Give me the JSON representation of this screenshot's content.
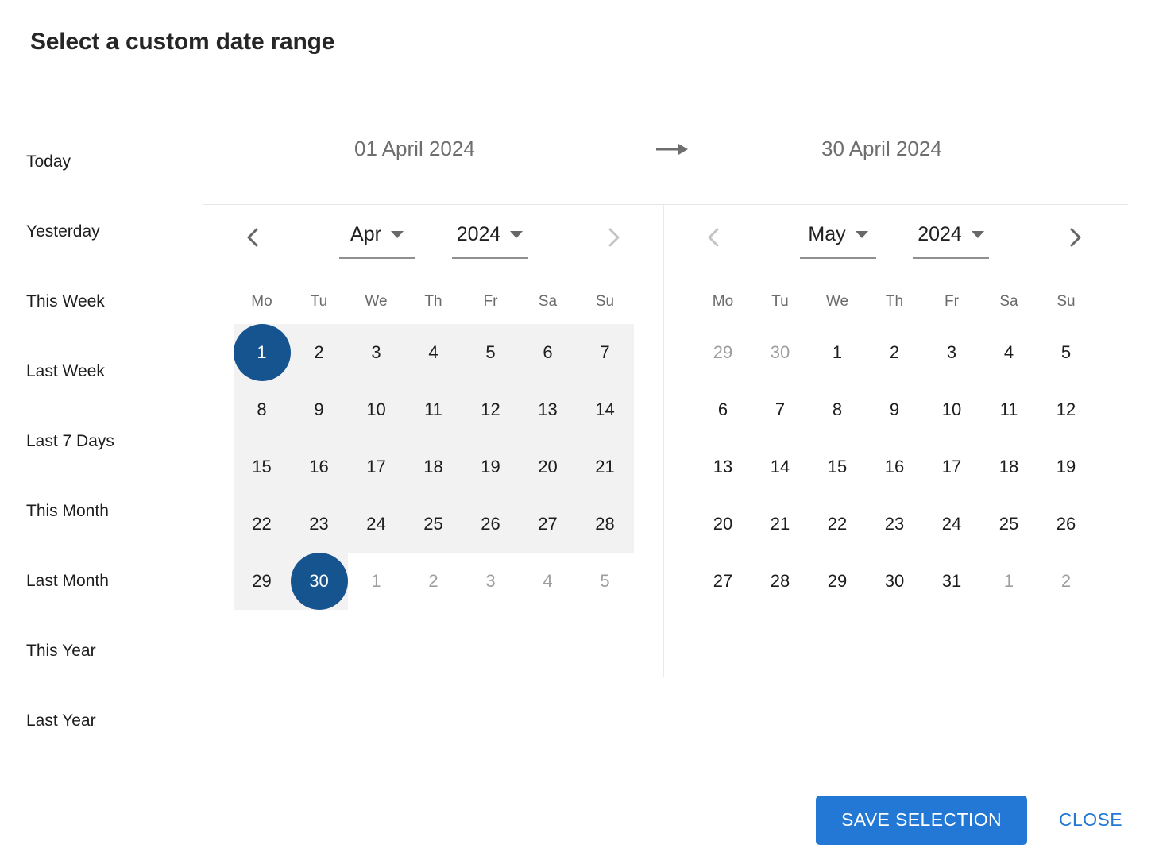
{
  "dialog": {
    "title": "Select a custom date range"
  },
  "presets": {
    "items": [
      {
        "label": "Today"
      },
      {
        "label": "Yesterday"
      },
      {
        "label": "This Week"
      },
      {
        "label": "Last Week"
      },
      {
        "label": "Last 7 Days"
      },
      {
        "label": "This Month"
      },
      {
        "label": "Last Month"
      },
      {
        "label": "This Year"
      },
      {
        "label": "Last Year"
      }
    ]
  },
  "range": {
    "start_label": "01 April 2024",
    "end_label": "30 April 2024",
    "arrow_icon": "arrow-right-icon"
  },
  "weekdays": [
    "Mo",
    "Tu",
    "We",
    "Th",
    "Fr",
    "Sa",
    "Su"
  ],
  "calendars": [
    {
      "id": "left",
      "month": "Apr",
      "year": "2024",
      "prev_icon": "chevron-left-icon",
      "next_icon": "chevron-right-icon",
      "prev_enabled": true,
      "next_enabled": false,
      "weeks": [
        [
          {
            "d": "1",
            "out": false,
            "selected": true,
            "inrange": true
          },
          {
            "d": "2",
            "out": false,
            "selected": false,
            "inrange": true
          },
          {
            "d": "3",
            "out": false,
            "selected": false,
            "inrange": true
          },
          {
            "d": "4",
            "out": false,
            "selected": false,
            "inrange": true
          },
          {
            "d": "5",
            "out": false,
            "selected": false,
            "inrange": true
          },
          {
            "d": "6",
            "out": false,
            "selected": false,
            "inrange": true
          },
          {
            "d": "7",
            "out": false,
            "selected": false,
            "inrange": true
          }
        ],
        [
          {
            "d": "8",
            "out": false,
            "selected": false,
            "inrange": true
          },
          {
            "d": "9",
            "out": false,
            "selected": false,
            "inrange": true
          },
          {
            "d": "10",
            "out": false,
            "selected": false,
            "inrange": true
          },
          {
            "d": "11",
            "out": false,
            "selected": false,
            "inrange": true
          },
          {
            "d": "12",
            "out": false,
            "selected": false,
            "inrange": true
          },
          {
            "d": "13",
            "out": false,
            "selected": false,
            "inrange": true
          },
          {
            "d": "14",
            "out": false,
            "selected": false,
            "inrange": true
          }
        ],
        [
          {
            "d": "15",
            "out": false,
            "selected": false,
            "inrange": true
          },
          {
            "d": "16",
            "out": false,
            "selected": false,
            "inrange": true
          },
          {
            "d": "17",
            "out": false,
            "selected": false,
            "inrange": true
          },
          {
            "d": "18",
            "out": false,
            "selected": false,
            "inrange": true
          },
          {
            "d": "19",
            "out": false,
            "selected": false,
            "inrange": true
          },
          {
            "d": "20",
            "out": false,
            "selected": false,
            "inrange": true
          },
          {
            "d": "21",
            "out": false,
            "selected": false,
            "inrange": true
          }
        ],
        [
          {
            "d": "22",
            "out": false,
            "selected": false,
            "inrange": true
          },
          {
            "d": "23",
            "out": false,
            "selected": false,
            "inrange": true
          },
          {
            "d": "24",
            "out": false,
            "selected": false,
            "inrange": true
          },
          {
            "d": "25",
            "out": false,
            "selected": false,
            "inrange": true
          },
          {
            "d": "26",
            "out": false,
            "selected": false,
            "inrange": true
          },
          {
            "d": "27",
            "out": false,
            "selected": false,
            "inrange": true
          },
          {
            "d": "28",
            "out": false,
            "selected": false,
            "inrange": true
          }
        ],
        [
          {
            "d": "29",
            "out": false,
            "selected": false,
            "inrange": true
          },
          {
            "d": "30",
            "out": false,
            "selected": true,
            "inrange": true
          },
          {
            "d": "1",
            "out": true,
            "selected": false,
            "inrange": false
          },
          {
            "d": "2",
            "out": true,
            "selected": false,
            "inrange": false
          },
          {
            "d": "3",
            "out": true,
            "selected": false,
            "inrange": false
          },
          {
            "d": "4",
            "out": true,
            "selected": false,
            "inrange": false
          },
          {
            "d": "5",
            "out": true,
            "selected": false,
            "inrange": false
          }
        ]
      ]
    },
    {
      "id": "right",
      "month": "May",
      "year": "2024",
      "prev_icon": "chevron-left-icon",
      "next_icon": "chevron-right-icon",
      "prev_enabled": false,
      "next_enabled": true,
      "weeks": [
        [
          {
            "d": "29",
            "out": true,
            "selected": false,
            "inrange": false
          },
          {
            "d": "30",
            "out": true,
            "selected": false,
            "inrange": false
          },
          {
            "d": "1",
            "out": false,
            "selected": false,
            "inrange": false
          },
          {
            "d": "2",
            "out": false,
            "selected": false,
            "inrange": false
          },
          {
            "d": "3",
            "out": false,
            "selected": false,
            "inrange": false
          },
          {
            "d": "4",
            "out": false,
            "selected": false,
            "inrange": false
          },
          {
            "d": "5",
            "out": false,
            "selected": false,
            "inrange": false
          }
        ],
        [
          {
            "d": "6",
            "out": false,
            "selected": false,
            "inrange": false
          },
          {
            "d": "7",
            "out": false,
            "selected": false,
            "inrange": false
          },
          {
            "d": "8",
            "out": false,
            "selected": false,
            "inrange": false
          },
          {
            "d": "9",
            "out": false,
            "selected": false,
            "inrange": false
          },
          {
            "d": "10",
            "out": false,
            "selected": false,
            "inrange": false
          },
          {
            "d": "11",
            "out": false,
            "selected": false,
            "inrange": false
          },
          {
            "d": "12",
            "out": false,
            "selected": false,
            "inrange": false
          }
        ],
        [
          {
            "d": "13",
            "out": false,
            "selected": false,
            "inrange": false
          },
          {
            "d": "14",
            "out": false,
            "selected": false,
            "inrange": false
          },
          {
            "d": "15",
            "out": false,
            "selected": false,
            "inrange": false
          },
          {
            "d": "16",
            "out": false,
            "selected": false,
            "inrange": false
          },
          {
            "d": "17",
            "out": false,
            "selected": false,
            "inrange": false
          },
          {
            "d": "18",
            "out": false,
            "selected": false,
            "inrange": false
          },
          {
            "d": "19",
            "out": false,
            "selected": false,
            "inrange": false
          }
        ],
        [
          {
            "d": "20",
            "out": false,
            "selected": false,
            "inrange": false
          },
          {
            "d": "21",
            "out": false,
            "selected": false,
            "inrange": false
          },
          {
            "d": "22",
            "out": false,
            "selected": false,
            "inrange": false
          },
          {
            "d": "23",
            "out": false,
            "selected": false,
            "inrange": false
          },
          {
            "d": "24",
            "out": false,
            "selected": false,
            "inrange": false
          },
          {
            "d": "25",
            "out": false,
            "selected": false,
            "inrange": false
          },
          {
            "d": "26",
            "out": false,
            "selected": false,
            "inrange": false
          }
        ],
        [
          {
            "d": "27",
            "out": false,
            "selected": false,
            "inrange": false
          },
          {
            "d": "28",
            "out": false,
            "selected": false,
            "inrange": false
          },
          {
            "d": "29",
            "out": false,
            "selected": false,
            "inrange": false
          },
          {
            "d": "30",
            "out": false,
            "selected": false,
            "inrange": false
          },
          {
            "d": "31",
            "out": false,
            "selected": false,
            "inrange": false
          },
          {
            "d": "1",
            "out": true,
            "selected": false,
            "inrange": false
          },
          {
            "d": "2",
            "out": true,
            "selected": false,
            "inrange": false
          }
        ]
      ]
    }
  ],
  "footer": {
    "save_label": "SAVE SELECTION",
    "close_label": "CLOSE"
  },
  "colors": {
    "accent_button": "#2278d4",
    "selected_day": "#15548f",
    "range_background": "#f2f2f2",
    "divider": "#e6e6e6"
  }
}
